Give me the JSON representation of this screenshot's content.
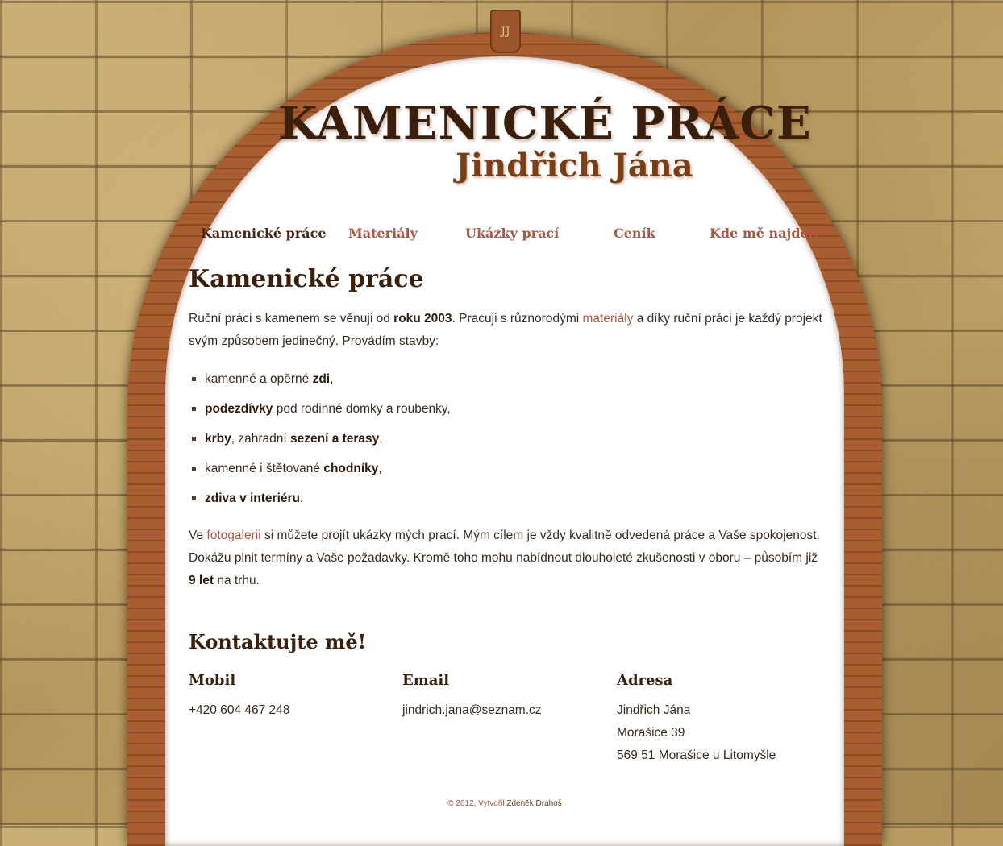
{
  "header": {
    "keystone": "JJ",
    "title": "KAMENICKÉ PRÁCE",
    "subtitle": "Jindřich Jána"
  },
  "nav": {
    "items": [
      {
        "label": "Kamenické práce",
        "active": true
      },
      {
        "label": "Materiály",
        "active": false
      },
      {
        "label": "Ukázky prací",
        "active": false
      },
      {
        "label": "Ceník",
        "active": false
      },
      {
        "label": "Kde mě najdete",
        "active": false
      }
    ]
  },
  "main": {
    "heading": "Kamenické práce",
    "intro": {
      "t1": "Ruční práci s kamenem se věnuji od ",
      "b1": "roku 2003",
      "t2": ". Pracuji s různorodými ",
      "link": "materiály",
      "t3": " a díky ruční práci je každý projekt svým způsobem jedinečný. Provádím stavby:"
    },
    "features": [
      {
        "pre": "kamenné a opěrné ",
        "bold": "zdi",
        "post": ","
      },
      {
        "pre": "",
        "bold": "podezdívky",
        "post": " pod rodinné domky a roubenky,"
      },
      {
        "pre": "",
        "bold": "krby",
        "post": ", zahradní "
      },
      {
        "pre": "kamenné i štětované ",
        "bold": "chodníky",
        "post": ","
      },
      {
        "pre": "",
        "bold": "zdiva v interiéru",
        "post": "."
      }
    ],
    "feature3_bold2": "sezení a terasy",
    "feature3_post2": ",",
    "outro": {
      "t1": "Ve ",
      "link": "fotogalerii",
      "t2": " si můžete projít ukázky mých prací. Mým cílem je vždy kvalitně odvedená práce a Vaše spokojenost. Dokážu plnit termíny a Vaše požadavky. Kromě toho mohu nabídnout dlouholeté zkušenosti v oboru – působím již ",
      "b1": "9 let",
      "t3": " na trhu."
    }
  },
  "contact": {
    "title": "Kontaktujte mě!",
    "mobile_label": "Mobil",
    "mobile": "+420 604 467 248",
    "email_label": "Email",
    "email": "jindrich.jana@seznam.cz",
    "address_label": "Adresa",
    "address_lines": [
      "Jindřich Jána",
      "Morašice 39",
      "569 51 Morašice u Litomyšle"
    ]
  },
  "footer": {
    "prefix": "© 2012, Vytvořil ",
    "author": "Zdeněk Drahoš"
  },
  "colors": {
    "link": "#b0553f",
    "heading": "#3a1f0c",
    "brick": "#a05a2c"
  }
}
